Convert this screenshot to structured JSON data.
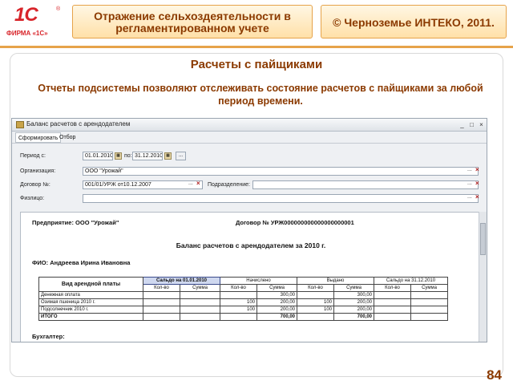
{
  "logo": {
    "mark": "1С",
    "sub": "ФИРМА «1С»",
    "reg": "®"
  },
  "header": {
    "title": "Отражение сельхоздеятельности в регламентированном учете",
    "copyright": "© Черноземье ИНТЕКО, 2011."
  },
  "slide": {
    "title": "Расчеты с пайщиками",
    "description": "Отчеты подсистемы позволяют отслеживать состояние расчетов с пайщиками за любой период времени.",
    "page_number": "84"
  },
  "window": {
    "title": "Баланс расчетов с арендодателем",
    "toolbar": {
      "generate": "Сформировать",
      "filter": "Отбор"
    },
    "form": {
      "period_label": "Период с:",
      "period_from": "01.01.2010",
      "period_to_label": "по:",
      "period_to": "31.12.2010",
      "org_label": "Организация:",
      "org_value": "ООО \"Урожай\"",
      "contract_label": "Договор №:",
      "contract_value": "001/01/УРЖ от10.12.2007",
      "division_label": "Подразделение:",
      "division_value": "",
      "person_label": "Физлицо:",
      "person_value": ""
    },
    "report": {
      "enterprise": "Предприятие: ООО \"Урожай\"",
      "contract": "Договор № УРЖ000000000000000000001",
      "title": "Баланс расчетов с арендодателем за 2010 г.",
      "fio": "ФИО: Андреева Ирина Ивановна",
      "table": {
        "col_main": "Вид арендной платы",
        "groups": [
          "Сальдо на 01.01.2010",
          "Начислено",
          "Выдано",
          "Сальдо на 31.12.2010"
        ],
        "sub": [
          "Кол-во",
          "Сумма"
        ],
        "rows": [
          {
            "name": "Денежная оплата",
            "c": [
              "",
              "",
              "",
              "300,00",
              "",
              "300,00",
              "",
              ""
            ]
          },
          {
            "name": "Озимая пшеница 2010 г.",
            "c": [
              "",
              "",
              "100",
              "200,00",
              "100",
              "200,00",
              "",
              ""
            ]
          },
          {
            "name": "Подсолнечник 2010 г.",
            "c": [
              "",
              "",
              "100",
              "200,00",
              "100",
              "200,00",
              "",
              ""
            ]
          },
          {
            "name": "ИТОГО",
            "c": [
              "",
              "",
              "",
              "700,00",
              "",
              "700,00",
              "",
              ""
            ]
          }
        ]
      },
      "footer": "Бухгалтер:"
    }
  }
}
